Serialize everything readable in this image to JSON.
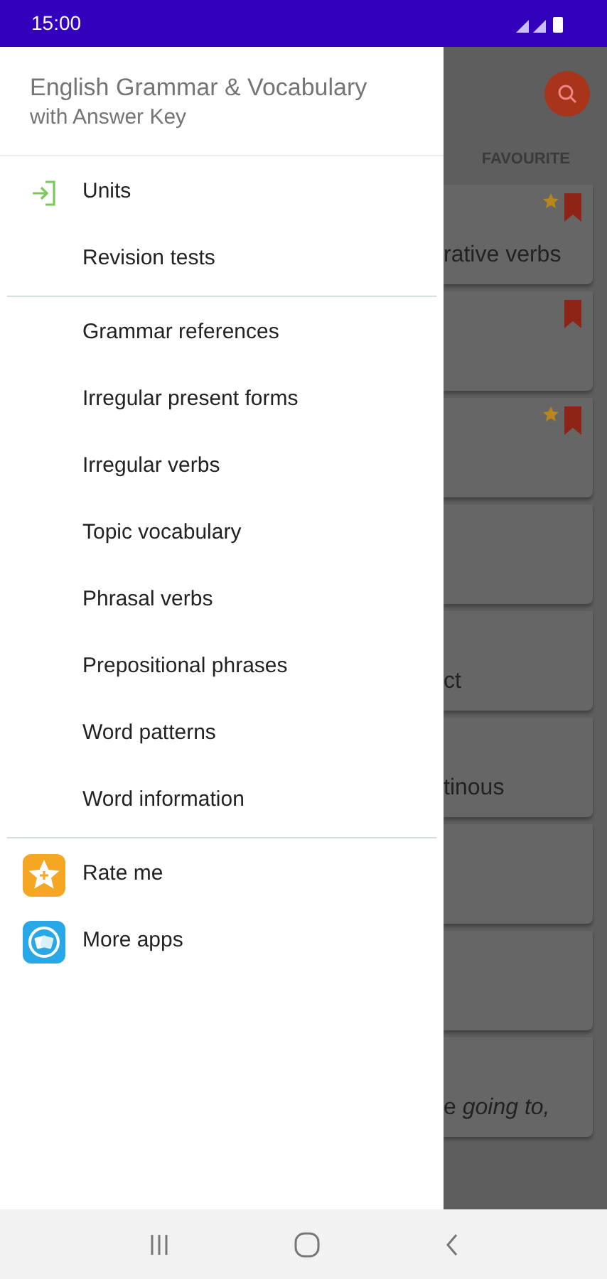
{
  "status_bar": {
    "time": "15:00"
  },
  "drawer": {
    "title": "English Grammar & Vocabulary",
    "subtitle": "with Answer Key",
    "sections": [
      {
        "items": [
          {
            "label": "Units",
            "kind": "enter"
          },
          {
            "label": "Revision tests",
            "kind": "plain"
          }
        ]
      },
      {
        "items": [
          {
            "label": "Grammar references",
            "kind": "plain"
          },
          {
            "label": "Irregular present forms",
            "kind": "plain"
          },
          {
            "label": "Irregular verbs",
            "kind": "plain"
          },
          {
            "label": "Topic vocabulary",
            "kind": "plain"
          },
          {
            "label": "Phrasal verbs",
            "kind": "plain"
          },
          {
            "label": "Prepositional phrases",
            "kind": "plain"
          },
          {
            "label": "Word patterns",
            "kind": "plain"
          },
          {
            "label": "Word information",
            "kind": "plain"
          }
        ]
      },
      {
        "items": [
          {
            "label": "Rate me",
            "kind": "rate"
          },
          {
            "label": "More apps",
            "kind": "apps"
          }
        ]
      }
    ]
  },
  "background": {
    "tab": "FAVOURITE",
    "cards": [
      {
        "text": "rative verbs",
        "starred": true,
        "bookmarked": true
      },
      {
        "starred": false,
        "bookmarked": true
      },
      {
        "starred": true,
        "bookmarked": true
      },
      {
        "starred": false,
        "bookmarked": false
      },
      {
        "text": "ct",
        "starred": false,
        "bookmarked": false
      },
      {
        "text": "tinous",
        "starred": false,
        "bookmarked": false
      },
      {
        "starred": false,
        "bookmarked": false
      },
      {
        "starred": false,
        "bookmarked": false
      },
      {
        "text": "e *going to,*",
        "starred": false,
        "bookmarked": false
      }
    ]
  }
}
